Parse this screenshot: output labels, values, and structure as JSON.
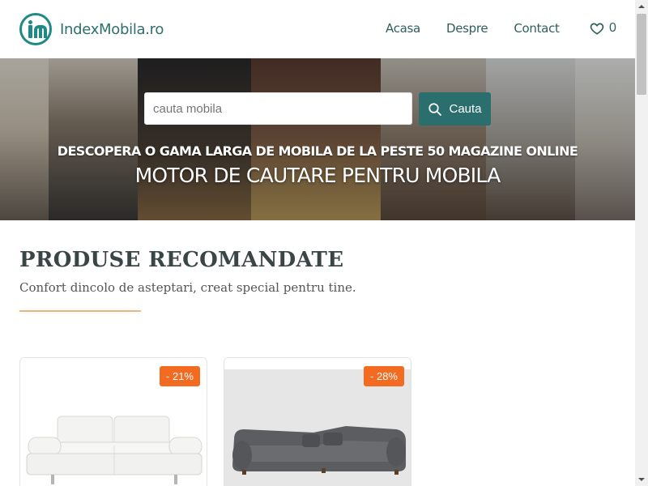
{
  "header": {
    "logo_text": "IndexMobila.ro",
    "nav": [
      "Acasa",
      "Despre",
      "Contact"
    ],
    "favorites_count": "0"
  },
  "hero": {
    "search_placeholder": "cauta mobila",
    "search_button": "Cauta",
    "subtitle": "DESCOPERA O GAMA LARGA DE MOBILA DE LA PESTE 50 MAGAZINE ONLINE",
    "title": "MOTOR DE CAUTARE PENTRU MOBILA"
  },
  "section": {
    "title": "PRODUSE RECOMANDATE",
    "subtitle": "Confort dincolo de asteptari, creat special pentru tine."
  },
  "products": [
    {
      "discount": "- 21%"
    },
    {
      "discount": "- 28%"
    }
  ],
  "colors": {
    "brand": "#1f8a84",
    "button": "#2a6f6d",
    "badge": "#f26b21",
    "accent_line": "#f2b27c"
  },
  "icons": {
    "logo": "logo-icon",
    "favorites": "heart-icon",
    "search": "search-icon"
  }
}
